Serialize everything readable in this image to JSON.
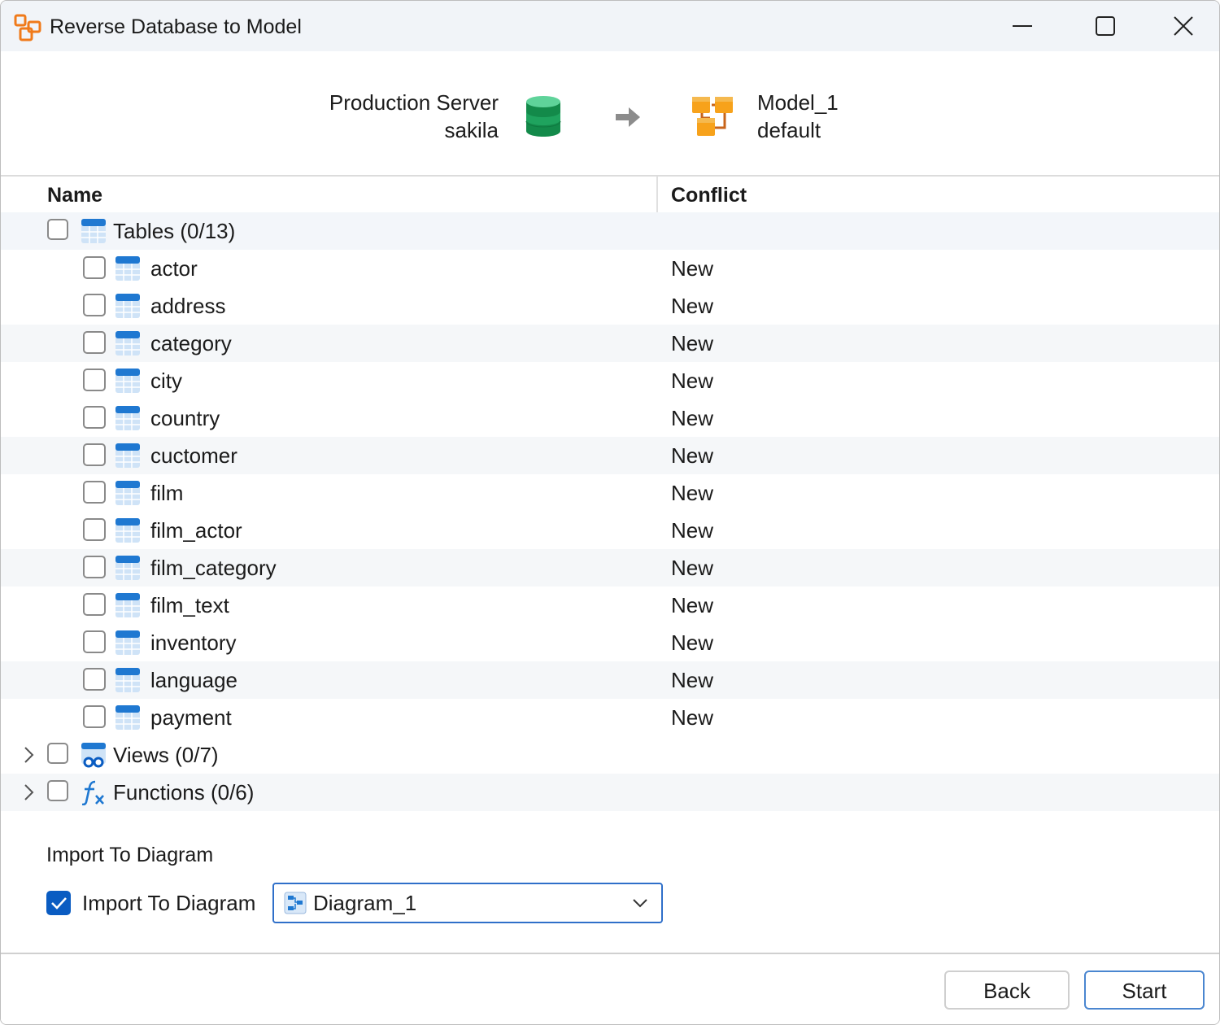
{
  "window": {
    "title": "Reverse Database to Model"
  },
  "source": {
    "server": "Production Server",
    "database": "sakila"
  },
  "target": {
    "model": "Model_1",
    "schema": "default"
  },
  "columns": {
    "name": "Name",
    "conflict": "Conflict"
  },
  "tree": {
    "tables_label": "Tables (0/13)",
    "tables": [
      {
        "name": "actor",
        "conflict": "New"
      },
      {
        "name": "address",
        "conflict": "New"
      },
      {
        "name": "category",
        "conflict": "New"
      },
      {
        "name": "city",
        "conflict": "New"
      },
      {
        "name": "country",
        "conflict": "New"
      },
      {
        "name": "cuctomer",
        "conflict": "New"
      },
      {
        "name": "film",
        "conflict": "New"
      },
      {
        "name": "film_actor",
        "conflict": "New"
      },
      {
        "name": "film_category",
        "conflict": "New"
      },
      {
        "name": "film_text",
        "conflict": "New"
      },
      {
        "name": "inventory",
        "conflict": "New"
      },
      {
        "name": "language",
        "conflict": "New"
      },
      {
        "name": "payment",
        "conflict": "New"
      }
    ],
    "views_label": "Views (0/7)",
    "functions_label": "Functions (0/6)"
  },
  "import": {
    "heading": "Import To Diagram",
    "checkbox_label": "Import To Diagram",
    "checked": true,
    "diagram_value": "Diagram_1"
  },
  "buttons": {
    "back": "Back",
    "start": "Start"
  },
  "colors": {
    "accent": "#0a5cc2",
    "db_green": "#1e9e5a",
    "model_orange": "#f39a1e",
    "table_blue": "#2b7fd4"
  }
}
